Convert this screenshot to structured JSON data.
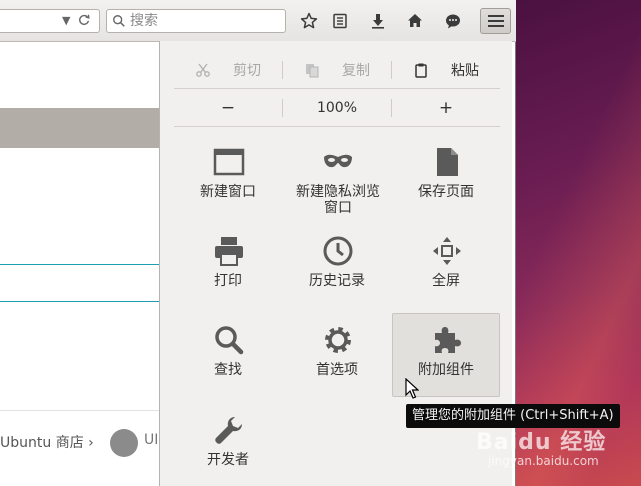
{
  "toolbar": {
    "search_placeholder": "搜索",
    "icons": [
      "bookmark-star-icon",
      "reading-list-icon",
      "downloads-icon",
      "home-icon",
      "chat-icon",
      "menu-icon"
    ]
  },
  "page": {
    "footer_link": "Ubuntu 商店 ›",
    "footer_text": "UI"
  },
  "menu": {
    "edit": {
      "cut": "剪切",
      "copy": "复制",
      "paste": "粘贴"
    },
    "zoom": {
      "out": "−",
      "level": "100%",
      "in": "+"
    },
    "items": [
      {
        "label": "新建窗口",
        "icon": "new-window-icon"
      },
      {
        "label": "新建隐私浏览窗口",
        "icon": "private-browsing-mask-icon"
      },
      {
        "label": "保存页面",
        "icon": "save-page-icon"
      },
      {
        "label": "打印",
        "icon": "print-icon"
      },
      {
        "label": "历史记录",
        "icon": "history-clock-icon"
      },
      {
        "label": "全屏",
        "icon": "fullscreen-icon"
      },
      {
        "label": "查找",
        "icon": "find-magnifier-icon"
      },
      {
        "label": "首选项",
        "icon": "preferences-gear-icon"
      },
      {
        "label": "附加组件",
        "icon": "addons-puzzle-icon"
      },
      {
        "label": "开发者",
        "icon": "developer-wrench-icon"
      }
    ]
  },
  "tooltip": "管理您的附加组件 (Ctrl+Shift+A)",
  "watermark": {
    "line1": "Baidu 经验",
    "line2": "jingyan.baidu.com"
  },
  "colors": {
    "panel_bg": "#f1f0ee",
    "icon_gray": "#5a5a5a",
    "accent_teal": "#1c9fb0",
    "desktop": "#6a1d52"
  }
}
